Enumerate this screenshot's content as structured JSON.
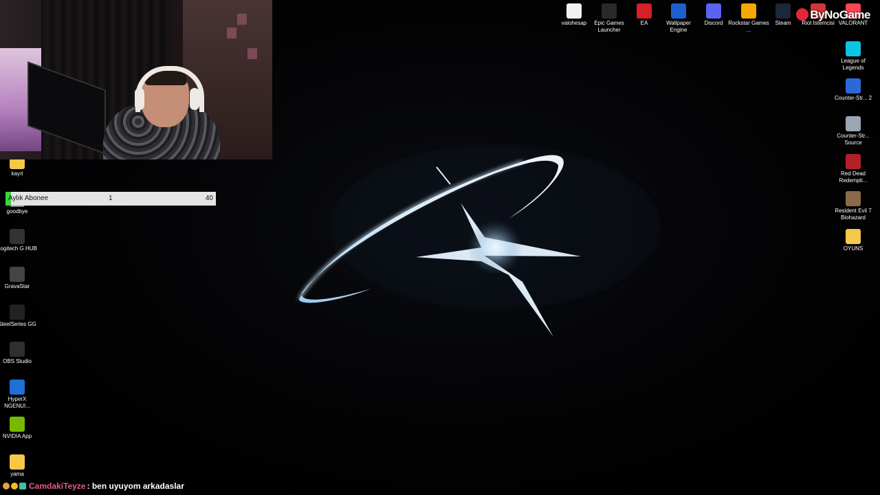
{
  "desktop": {
    "top_icons": [
      {
        "name": "valohesap",
        "icon": "text-file-icon",
        "color": "#f2f2f2"
      },
      {
        "name": "Epic Games Launcher",
        "icon": "epic-games-icon",
        "color": "#2a2a2a"
      },
      {
        "name": "EA",
        "icon": "ea-icon",
        "color": "#d61f26"
      },
      {
        "name": "Wallpaper Engine",
        "icon": "wallpaper-engine-icon",
        "color": "#1e5fd0"
      },
      {
        "name": "Discord",
        "icon": "discord-icon",
        "color": "#5865f2"
      },
      {
        "name": "Rockstar Games ...",
        "icon": "rockstar-icon",
        "color": "#f5a800"
      },
      {
        "name": "Steam",
        "icon": "steam-icon",
        "color": "#1b2838"
      },
      {
        "name": "Riot İstemcisi",
        "icon": "riot-icon",
        "color": "#d13639"
      },
      {
        "name": "VALORANT",
        "icon": "valorant-icon",
        "color": "#fd4556"
      }
    ],
    "right_icons": [
      {
        "name": "League of Legends",
        "icon": "league-icon",
        "color": "#0bc6e3"
      },
      {
        "name": "Counter-Str... 2",
        "icon": "cs2-icon",
        "color": "#2b6ad6"
      },
      {
        "name": "Counter-Str... Source",
        "icon": "css-icon",
        "color": "#9aa6b2"
      },
      {
        "name": "Red Dead Redempti...",
        "icon": "rdr-icon",
        "color": "#b3202a"
      },
      {
        "name": "Resident Evil 7 Biohazard",
        "icon": "re7-icon",
        "color": "#8a6a4a"
      },
      {
        "name": "OYUNS",
        "icon": "folder-icon",
        "color": "#f4c84a"
      }
    ],
    "left_icons": [
      {
        "name": "kayıt",
        "icon": "folder-icon",
        "color": "#f4c84a"
      },
      {
        "name": "goodbye",
        "icon": "file-icon",
        "color": "#888888"
      },
      {
        "name": "Logitech G HUB",
        "icon": "logitech-icon",
        "color": "#333333"
      },
      {
        "name": "GravaStar",
        "icon": "gravastar-icon",
        "color": "#444444"
      },
      {
        "name": "SteelSeries GG",
        "icon": "steelseries-icon",
        "color": "#222222"
      },
      {
        "name": "OBS Studio",
        "icon": "obs-icon",
        "color": "#2f2f2f"
      },
      {
        "name": "HyperX NGENUI...",
        "icon": "hyperx-icon",
        "color": "#1f6fd6"
      },
      {
        "name": "NVIDIA App",
        "icon": "nvidia-icon",
        "color": "#76b900"
      },
      {
        "name": "yama",
        "icon": "folder-icon",
        "color": "#f4c84a"
      }
    ]
  },
  "sub_goal": {
    "label": "Aylık Abonee",
    "current": "1",
    "target": "40",
    "progress": 0.025,
    "fill_color": "#3dd43d"
  },
  "chat": {
    "username": "CamdakiTeyze",
    "message": ": ben uyuyom arkadaslar",
    "username_color": "#e05e8e"
  },
  "watermark": {
    "text": "ByNoGame"
  }
}
